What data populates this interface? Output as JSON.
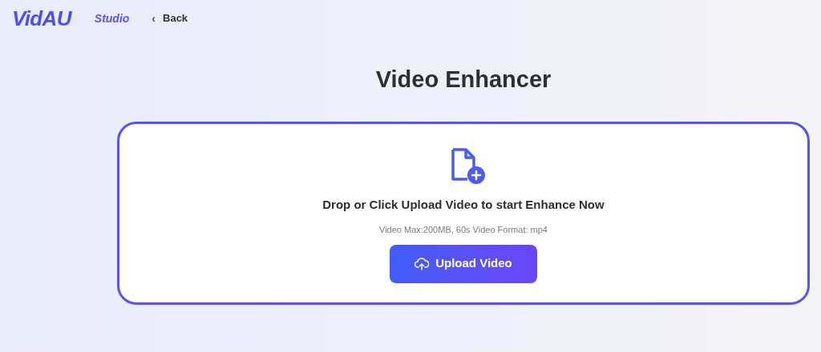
{
  "header": {
    "logo": "VidAU",
    "product": "Studio",
    "back": {
      "icon": "‹",
      "label": "Back"
    }
  },
  "title": "Video Enhancer",
  "upload_area": {
    "heading": "Drop or Click Upload Video to start Enhance Now",
    "limits": "Video Max:200MB, 60s Video Format: mp4",
    "button": "Upload Video"
  }
}
